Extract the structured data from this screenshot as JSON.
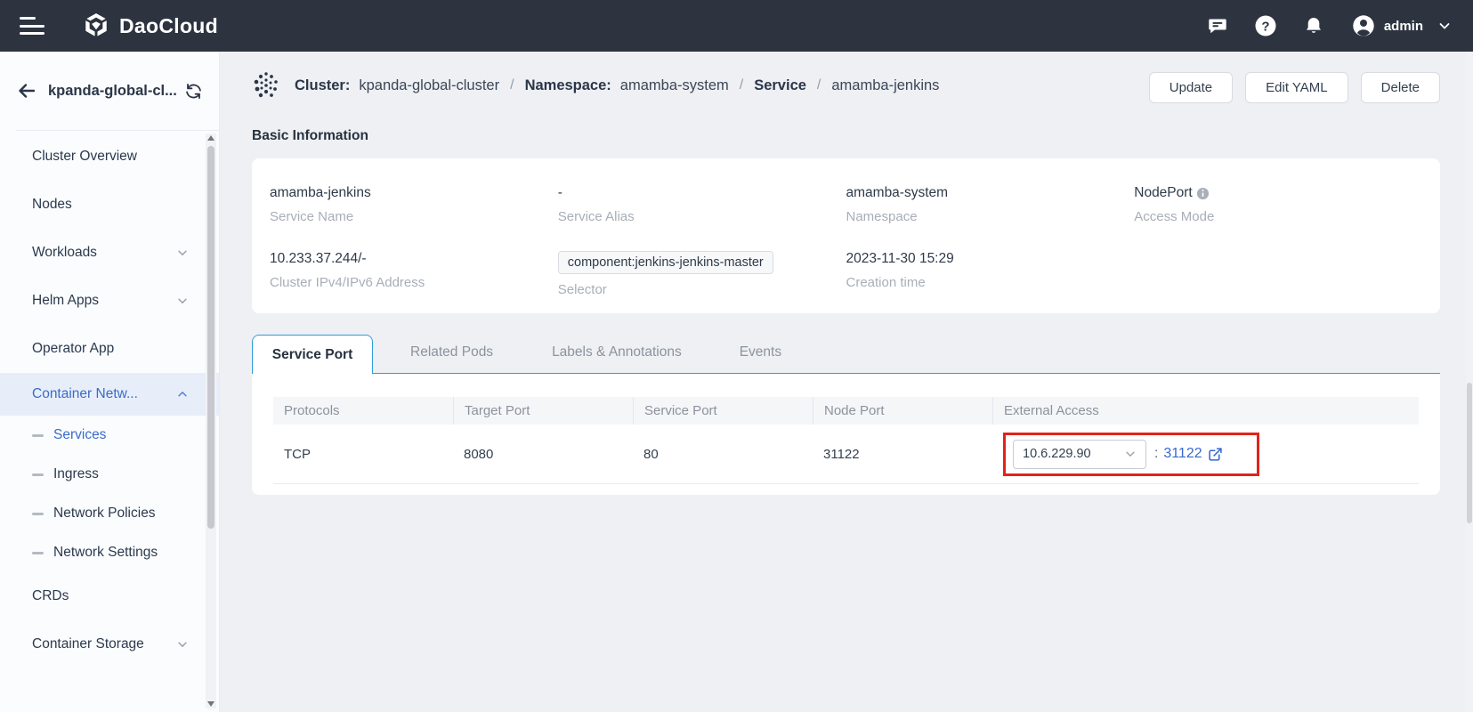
{
  "topbar": {
    "brand": "DaoCloud",
    "user": "admin"
  },
  "icons": {
    "hamburger": "menu",
    "message": "chat-bubble",
    "help": "question-circle",
    "notification": "bell",
    "avatar": "person-circle",
    "caret": "chevron-down",
    "back": "arrow-left",
    "switch_cluster": "refresh-swap",
    "cluster_badge": "dot-cluster",
    "info": "info-circle",
    "external_link": "arrow-out-of-box"
  },
  "sidebar": {
    "cluster_name": "kpanda-global-cl...",
    "items": [
      {
        "label": "Cluster Overview"
      },
      {
        "label": "Nodes"
      },
      {
        "label": "Workloads"
      },
      {
        "label": "Helm Apps"
      },
      {
        "label": "Operator App"
      },
      {
        "label": "Container Netw..."
      },
      {
        "label": "Services"
      },
      {
        "label": "Ingress"
      },
      {
        "label": "Network Policies"
      },
      {
        "label": "Network Settings"
      },
      {
        "label": "CRDs"
      },
      {
        "label": "Container Storage"
      }
    ]
  },
  "breadcrumb": {
    "cluster_label": "Cluster:",
    "cluster_value": "kpanda-global-cluster",
    "sep1": "/",
    "namespace_label": "Namespace:",
    "namespace_value": "amamba-system",
    "sep2": "/",
    "resource_type": "Service",
    "sep3": "/",
    "resource_name": "amamba-jenkins"
  },
  "actions": {
    "update": "Update",
    "edit_yaml": "Edit YAML",
    "delete": "Delete"
  },
  "basic_info": {
    "title": "Basic Information",
    "fields": [
      {
        "value": "amamba-jenkins",
        "label": "Service Name"
      },
      {
        "value": "-",
        "label": "Service Alias"
      },
      {
        "value": "amamba-system",
        "label": "Namespace"
      },
      {
        "value": "NodePort",
        "label": "Access Mode"
      },
      {
        "value": "10.233.37.244/-",
        "label": "Cluster IPv4/IPv6 Address"
      },
      {
        "value": "component:jenkins-jenkins-master",
        "label": "Selector"
      },
      {
        "value": "2023-11-30 15:29",
        "label": "Creation time"
      }
    ]
  },
  "tabs": [
    {
      "label": "Service Port"
    },
    {
      "label": "Related Pods"
    },
    {
      "label": "Labels & Annotations"
    },
    {
      "label": "Events"
    }
  ],
  "port_table": {
    "columns": [
      "Protocols",
      "Target Port",
      "Service Port",
      "Node Port",
      "External Access"
    ],
    "rows": [
      {
        "protocol": "TCP",
        "target_port": "8080",
        "service_port": "80",
        "node_port": "31122",
        "external_ip": "10.6.229.90",
        "external_colon": ":",
        "external_port": "31122"
      }
    ]
  },
  "colors": {
    "topbar_bg": "#2d3440",
    "page_bg": "#eef0f4",
    "accent_blue": "#3568d4",
    "active_item_bg": "#e8eef9",
    "active_item_text": "#3a6cc8",
    "tab_border_blue": "#2f9cdb",
    "highlight_red": "#e2231a"
  }
}
